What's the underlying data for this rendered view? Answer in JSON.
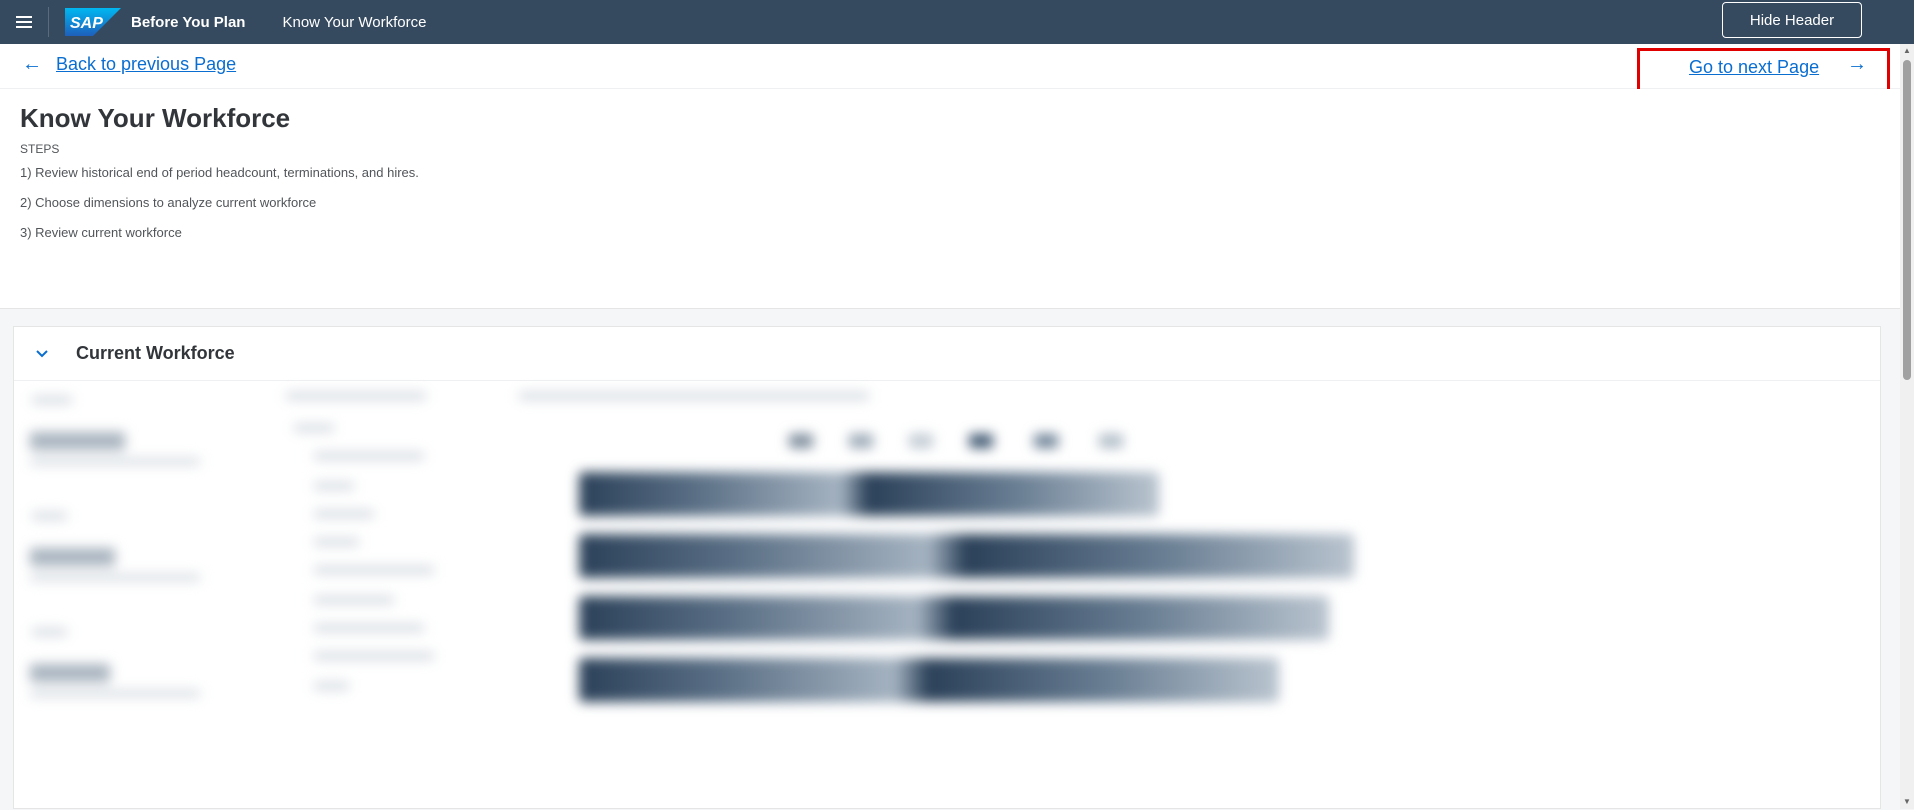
{
  "shell": {
    "app_title": "Before You Plan",
    "app_subtitle": "Know Your Workforce",
    "logo_text": "SAP",
    "hide_header_label": "Hide Header"
  },
  "nav": {
    "back_label": "Back to previous Page",
    "next_label": "Go to next Page"
  },
  "header": {
    "title": "Know Your Workforce",
    "steps_label": "STEPS",
    "steps": [
      "1) Review historical end of period headcount, terminations, and hires.",
      "2) Choose dimensions to analyze current workforce",
      "3) Review current workforce"
    ]
  },
  "panel": {
    "title": "Current Workforce"
  },
  "colors": {
    "shellbar": "#354a5f",
    "link": "#0a6ed1",
    "highlight": "#e00000"
  }
}
